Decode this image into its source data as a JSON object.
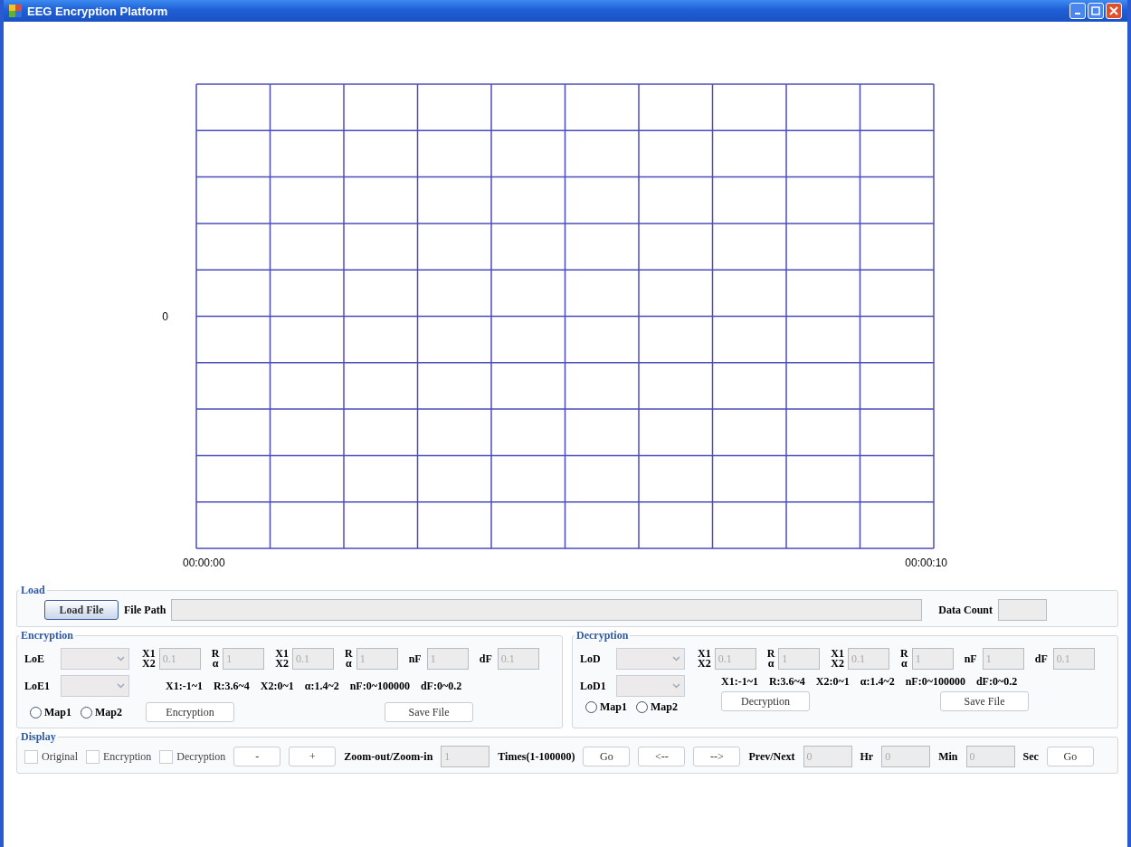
{
  "window": {
    "title": "EEG Encryption Platform"
  },
  "plot": {
    "y_label": "0",
    "x_start": "00:00:00",
    "x_end": "00:00:10"
  },
  "load": {
    "title": "Load",
    "button": "Load File",
    "path_label": "File Path",
    "count_label": "Data Count"
  },
  "panels": [
    {
      "title": "Encryption",
      "kind": "encryption",
      "selector1": "LoE",
      "selector2": "LoE1",
      "params": [
        {
          "kind": "stack",
          "top": "X1",
          "bottom": "X2",
          "value": "0.1"
        },
        {
          "kind": "stack",
          "top": "R",
          "bottom": "α",
          "value": "1"
        },
        {
          "kind": "stack",
          "top": "X1",
          "bottom": "X2",
          "value": "0.1"
        },
        {
          "kind": "stack",
          "top": "R",
          "bottom": "α",
          "value": "1"
        },
        {
          "kind": "inline",
          "label": "nF",
          "value": "1"
        },
        {
          "kind": "inline",
          "label": "dF",
          "value": "0.1"
        }
      ],
      "ranges": [
        "X1:-1~1",
        "R:3.6~4",
        "X2:0~1",
        "α:1.4~2",
        "nF:0~100000",
        "dF:0~0.2"
      ],
      "maps": [
        {
          "label": "Map1",
          "selected": false
        },
        {
          "label": "Map2",
          "selected": false
        }
      ],
      "action": "Encryption",
      "save": "Save File"
    },
    {
      "title": "Decryption",
      "kind": "decryption",
      "selector1": "LoD",
      "selector2": "LoD1",
      "params": [
        {
          "kind": "stack",
          "top": "X1",
          "bottom": "X2",
          "value": "0.1"
        },
        {
          "kind": "stack",
          "top": "R",
          "bottom": "α",
          "value": "1"
        },
        {
          "kind": "stack",
          "top": "X1",
          "bottom": "X2",
          "value": "0.1"
        },
        {
          "kind": "stack",
          "top": "R",
          "bottom": "α",
          "value": "1"
        },
        {
          "kind": "inline",
          "label": "nF",
          "value": "1"
        },
        {
          "kind": "inline",
          "label": "dF",
          "value": "0.1"
        }
      ],
      "ranges": [
        "X1:-1~1",
        "R:3.6~4",
        "X2:0~1",
        "α:1.4~2",
        "nF:0~100000",
        "dF:0~0.2"
      ],
      "maps": [
        {
          "label": "Map1",
          "selected": false
        },
        {
          "label": "Map2",
          "selected": false
        }
      ],
      "action": "Decryption",
      "save": "Save File"
    }
  ],
  "display": {
    "title": "Display",
    "items": [
      {
        "kind": "check",
        "label": "Original",
        "checked": false
      },
      {
        "kind": "check",
        "label": "Encryption",
        "checked": false
      },
      {
        "kind": "check",
        "label": "Decryption",
        "checked": false
      },
      {
        "kind": "button",
        "label": "-"
      },
      {
        "kind": "button",
        "label": "+"
      },
      {
        "kind": "label",
        "label": "Zoom-out/Zoom-in"
      },
      {
        "kind": "field",
        "value": "1"
      },
      {
        "kind": "label",
        "label": "Times(1-100000)"
      },
      {
        "kind": "button",
        "label": "Go"
      },
      {
        "kind": "button",
        "label": "<--"
      },
      {
        "kind": "button",
        "label": "-->"
      },
      {
        "kind": "label",
        "label": "Prev/Next"
      },
      {
        "kind": "field",
        "value": "0"
      },
      {
        "kind": "label",
        "label": "Hr"
      },
      {
        "kind": "field",
        "value": "0"
      },
      {
        "kind": "label",
        "label": "Min"
      },
      {
        "kind": "field",
        "value": "0"
      },
      {
        "kind": "label",
        "label": "Sec"
      },
      {
        "kind": "button",
        "label": "Go"
      }
    ]
  }
}
